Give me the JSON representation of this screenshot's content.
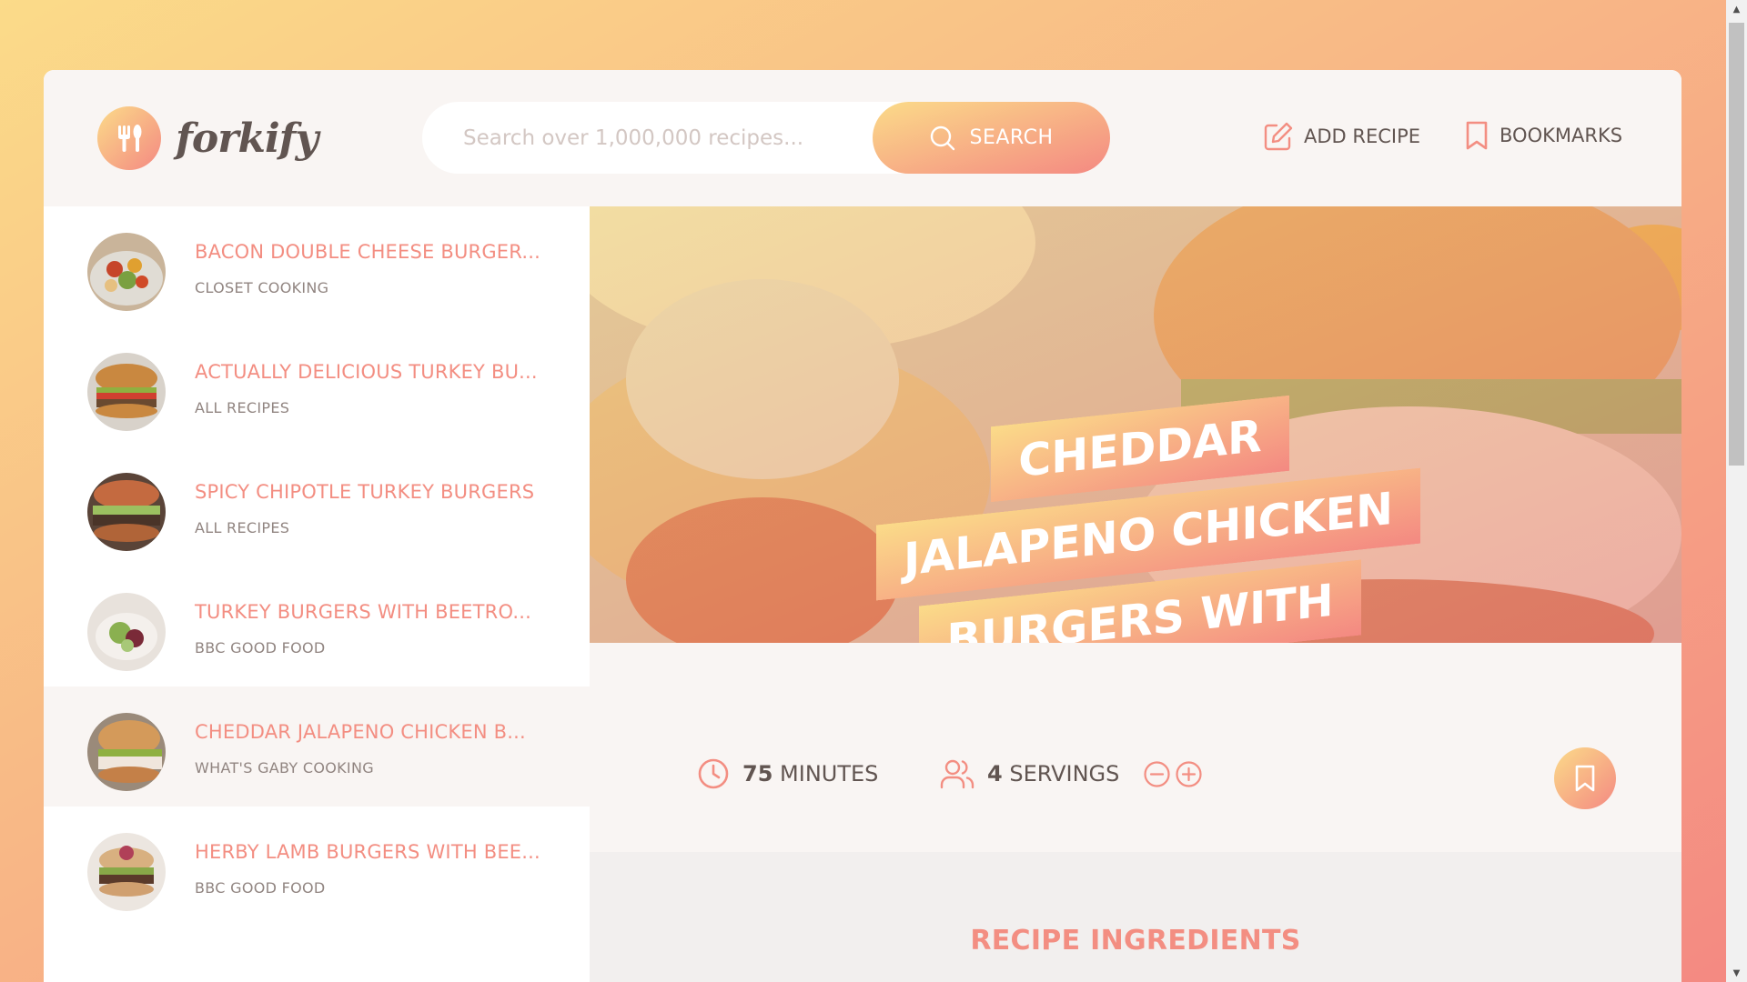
{
  "header": {
    "logo_text": "forkify",
    "search_placeholder": "Search over 1,000,000 recipes...",
    "search_button": "SEARCH",
    "add_recipe": "ADD RECIPE",
    "bookmarks": "BOOKMARKS"
  },
  "results": [
    {
      "title": "BACON DOUBLE CHEESE BURGER...",
      "publisher": "CLOSET COOKING",
      "active": false
    },
    {
      "title": "ACTUALLY DELICIOUS TURKEY BU...",
      "publisher": "ALL RECIPES",
      "active": false
    },
    {
      "title": "SPICY CHIPOTLE TURKEY BURGERS",
      "publisher": "ALL RECIPES",
      "active": false
    },
    {
      "title": "TURKEY BURGERS WITH BEETRO...",
      "publisher": "BBC GOOD FOOD",
      "active": false
    },
    {
      "title": "CHEDDAR JALAPENO CHICKEN B...",
      "publisher": "WHAT'S GABY COOKING",
      "active": true
    },
    {
      "title": "HERBY LAMB BURGERS WITH BEE...",
      "publisher": "BBC GOOD FOOD",
      "active": false
    }
  ],
  "recipe": {
    "title": "CHEDDAR JALAPENO CHICKEN BURGERS WITH GUACAMOLE",
    "minutes": "75",
    "minutes_label": "MINUTES",
    "servings": "4",
    "servings_label": "SERVINGS",
    "ingredients_heading": "RECIPE INGREDIENTS"
  },
  "colors": {
    "accent_start": "#fbdb89",
    "accent_end": "#f48982",
    "primary_text": "#615551",
    "accent_text": "#f38e82"
  },
  "icons": [
    "fork-knife-icon",
    "search-icon",
    "edit-icon",
    "bookmark-icon",
    "clock-icon",
    "users-icon",
    "minus-circle-icon",
    "plus-circle-icon"
  ]
}
